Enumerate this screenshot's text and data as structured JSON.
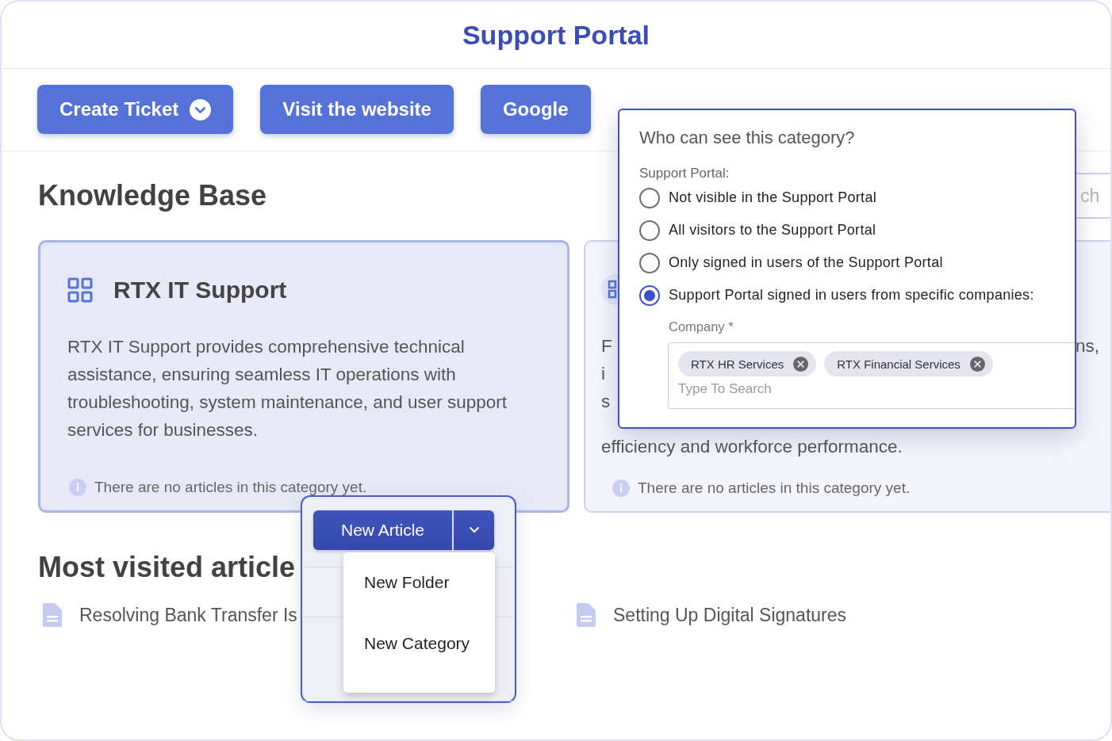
{
  "header": {
    "title": "Support Portal"
  },
  "actions": [
    {
      "label": "Create Ticket",
      "kind": "dropdown"
    },
    {
      "label": "Visit the website",
      "kind": "plain"
    },
    {
      "label": "Google",
      "kind": "plain"
    }
  ],
  "knowledge_base": {
    "title": "Knowledge Base",
    "search": {
      "placeholder": "ch"
    },
    "categories": [
      {
        "title": "RTX IT Support",
        "description": "RTX IT Support provides comprehensive technical assistance, ensuring seamless IT operations with troubleshooting, system maintenance, and user support services for businesses.",
        "empty_note": "There are no articles in this category yet."
      },
      {
        "description_lines": [
          {
            "start": "F",
            "end": "ns,"
          },
          {
            "start": "i"
          },
          {
            "start": "s"
          },
          {
            "start": "efficiency and workforce performance."
          }
        ],
        "empty_note": "There are no articles in this category yet."
      }
    ]
  },
  "most_visited": {
    "title": "Most visited article",
    "articles": [
      "Resolving Bank Transfer Is",
      "Setting Up Digital Signatures"
    ]
  },
  "visibility_popup": {
    "title": "Who can see this category?",
    "group_label": "Support Portal:",
    "options": [
      {
        "label": "Not visible in the Support Portal",
        "selected": false
      },
      {
        "label": "All visitors to the Support Portal",
        "selected": false
      },
      {
        "label": "Only signed in users of the Support Portal",
        "selected": false
      },
      {
        "label": "Support Portal signed in users from specific companies:",
        "selected": true
      }
    ],
    "company": {
      "label": "Company *",
      "chips": [
        "RTX HR Services",
        "RTX Financial Services"
      ],
      "placeholder": "Type To Search"
    }
  },
  "new_menu": {
    "primary": "New Article",
    "items": [
      "New Folder",
      "New Category"
    ]
  }
}
